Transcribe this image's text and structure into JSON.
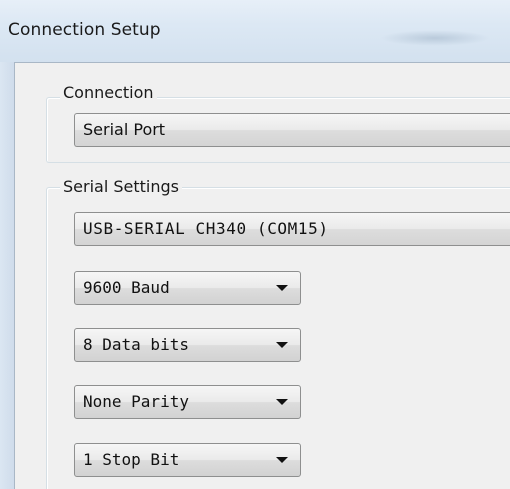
{
  "window": {
    "title": "Connection Setup"
  },
  "connection_group": {
    "label": "Connection",
    "selected": "Serial Port"
  },
  "serial_group": {
    "label": "Serial Settings",
    "port": "USB-SERIAL CH340 (COM15)",
    "baud": "9600 Baud",
    "data_bits": "8 Data bits",
    "parity": "None Parity",
    "stop_bits": "1 Stop Bit"
  },
  "icons": {
    "dropdown": "chevron-down-icon"
  },
  "colors": {
    "titlebar": "#dce8f4",
    "client_background": "#f0f0f0",
    "combo_border": "#8e8f8f"
  }
}
